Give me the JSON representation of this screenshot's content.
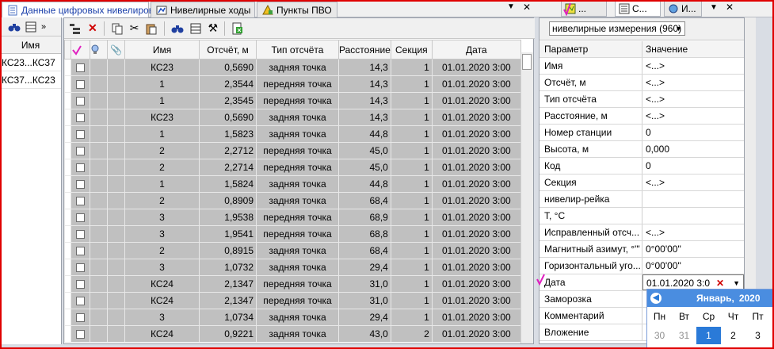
{
  "tabs": {
    "main": [
      "Данные цифровых нивелиров",
      "Нивелирные ходы",
      "Пункты ПВО"
    ],
    "right": [
      "...",
      "С...",
      "И..."
    ]
  },
  "left_list": {
    "header": "Имя",
    "rows": [
      "КС23...КС37",
      "КС37...КС23"
    ]
  },
  "grid": {
    "columns": [
      "",
      "",
      "",
      "Имя",
      "Отсчёт, м",
      "Тип отсчёта",
      "Расстояние",
      "Секция",
      "Дата"
    ],
    "rows": [
      [
        "КС23",
        "0,5690",
        "задняя точка",
        "14,3",
        "1",
        "01.01.2020 3:00"
      ],
      [
        "1",
        "2,3544",
        "передняя точка",
        "14,3",
        "1",
        "01.01.2020 3:00"
      ],
      [
        "1",
        "2,3545",
        "передняя точка",
        "14,3",
        "1",
        "01.01.2020 3:00"
      ],
      [
        "КС23",
        "0,5690",
        "задняя точка",
        "14,3",
        "1",
        "01.01.2020 3:00"
      ],
      [
        "1",
        "1,5823",
        "задняя точка",
        "44,8",
        "1",
        "01.01.2020 3:00"
      ],
      [
        "2",
        "2,2712",
        "передняя точка",
        "45,0",
        "1",
        "01.01.2020 3:00"
      ],
      [
        "2",
        "2,2714",
        "передняя точка",
        "45,0",
        "1",
        "01.01.2020 3:00"
      ],
      [
        "1",
        "1,5824",
        "задняя точка",
        "44,8",
        "1",
        "01.01.2020 3:00"
      ],
      [
        "2",
        "0,8909",
        "задняя точка",
        "68,4",
        "1",
        "01.01.2020 3:00"
      ],
      [
        "3",
        "1,9538",
        "передняя точка",
        "68,9",
        "1",
        "01.01.2020 3:00"
      ],
      [
        "3",
        "1,9541",
        "передняя точка",
        "68,8",
        "1",
        "01.01.2020 3:00"
      ],
      [
        "2",
        "0,8915",
        "задняя точка",
        "68,4",
        "1",
        "01.01.2020 3:00"
      ],
      [
        "3",
        "1,0732",
        "задняя точка",
        "29,4",
        "1",
        "01.01.2020 3:00"
      ],
      [
        "КС24",
        "2,1347",
        "передняя точка",
        "31,0",
        "1",
        "01.01.2020 3:00"
      ],
      [
        "КС24",
        "2,1347",
        "передняя точка",
        "31,0",
        "1",
        "01.01.2020 3:00"
      ],
      [
        "3",
        "1,0734",
        "задняя точка",
        "29,4",
        "1",
        "01.01.2020 3:00"
      ],
      [
        "КС24",
        "0,9221",
        "задняя точка",
        "43,0",
        "2",
        "01.01.2020 3:00"
      ]
    ]
  },
  "right_panel": {
    "combo": "нивелирные измерения (960)",
    "header": {
      "param": "Параметр",
      "value": "Значение"
    },
    "props": [
      [
        "Имя",
        "<...>"
      ],
      [
        "Отсчёт, м",
        "<...>"
      ],
      [
        "Тип отсчёта",
        "<...>"
      ],
      [
        "Расстояние, м",
        "<...>"
      ],
      [
        "Номер станции",
        "0"
      ],
      [
        "Высота, м",
        "0,000"
      ],
      [
        "Код",
        "0"
      ],
      [
        "Секция",
        "<...>"
      ],
      [
        "нивелир-рейка",
        ""
      ],
      [
        "T, °C",
        ""
      ],
      [
        "Исправленный отсч...",
        "<...>"
      ],
      [
        "Магнитный азимут, °'\"",
        "0°00'00\""
      ],
      [
        "Горизонтальный уго...",
        "0°00'00\""
      ],
      [
        "Дата",
        "01.01.2020 3:0"
      ],
      [
        "Заморозка",
        ""
      ],
      [
        "Комментарий",
        ""
      ],
      [
        "Вложение",
        ""
      ]
    ]
  },
  "calendar": {
    "month": "Январь,",
    "year": "2020",
    "weekdays": [
      "Пн",
      "Вт",
      "Ср",
      "Чт",
      "Пт"
    ],
    "days": [
      "30",
      "31",
      "1",
      "2",
      "3"
    ]
  },
  "colors": {
    "accent": "#1a3faa",
    "selected_rows": "#c0c0c0",
    "calendar_header": "#4a8de0",
    "frame": "#e00000"
  }
}
